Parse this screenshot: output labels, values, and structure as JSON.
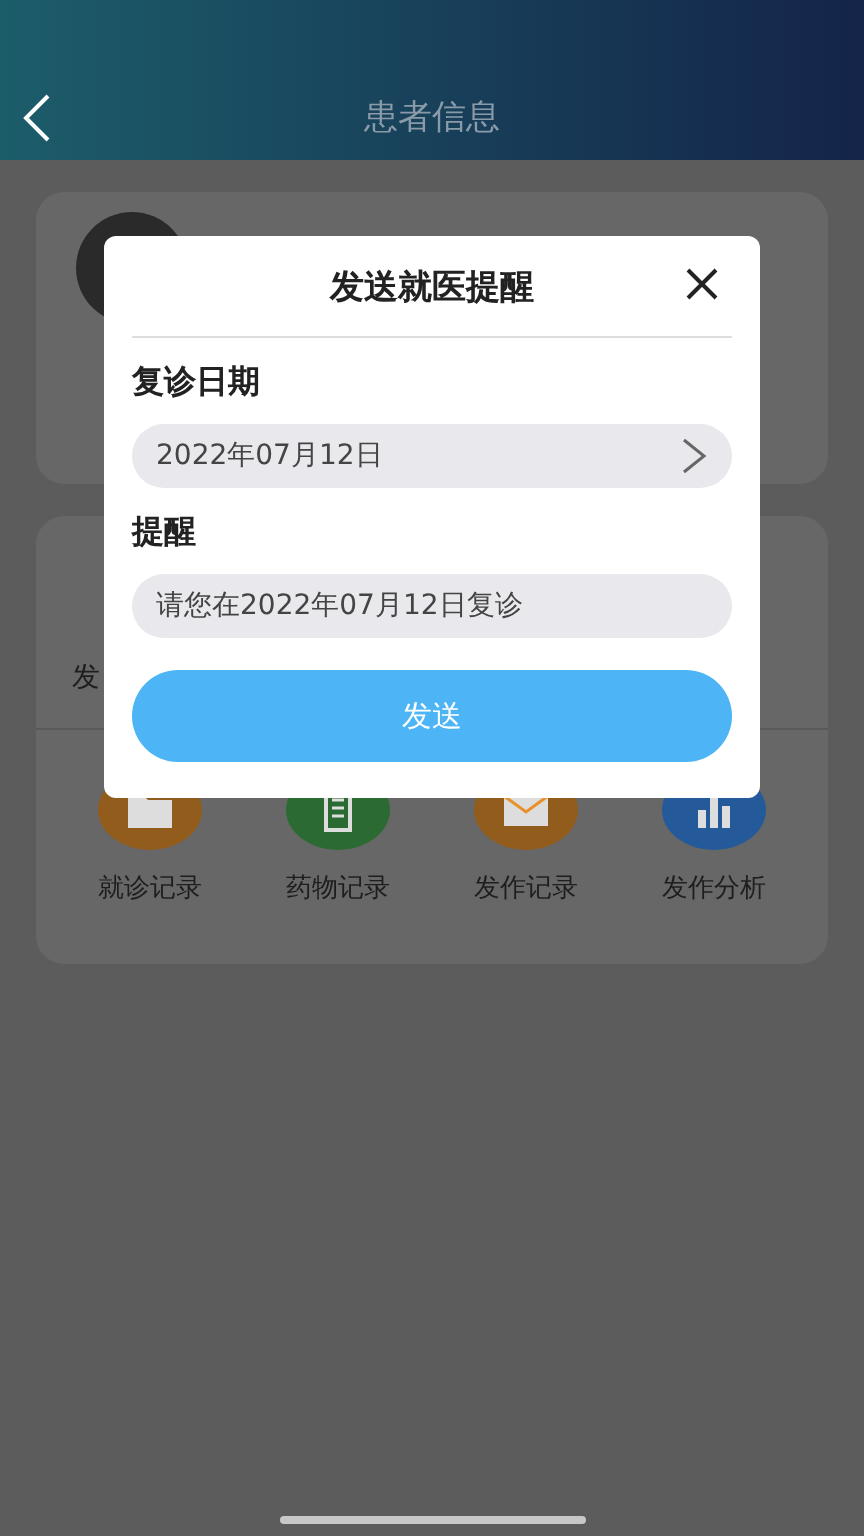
{
  "header": {
    "title": "患者信息"
  },
  "summary": {
    "left_label": "发"
  },
  "shortcuts": [
    {
      "label": "就诊记录",
      "kind": "folder",
      "color": "#925c1c"
    },
    {
      "label": "药物记录",
      "kind": "clipboard",
      "color": "#2b6b33"
    },
    {
      "label": "发作记录",
      "kind": "mail",
      "color": "#925c1c"
    },
    {
      "label": "发作分析",
      "kind": "chart",
      "color": "#255a9a"
    }
  ],
  "dialog": {
    "title": "发送就医提醒",
    "date_label": "复诊日期",
    "date_value": "2022年07月12日",
    "reminder_label": "提醒",
    "reminder_value": "请您在2022年07月12日复诊",
    "send_button": "发送"
  }
}
